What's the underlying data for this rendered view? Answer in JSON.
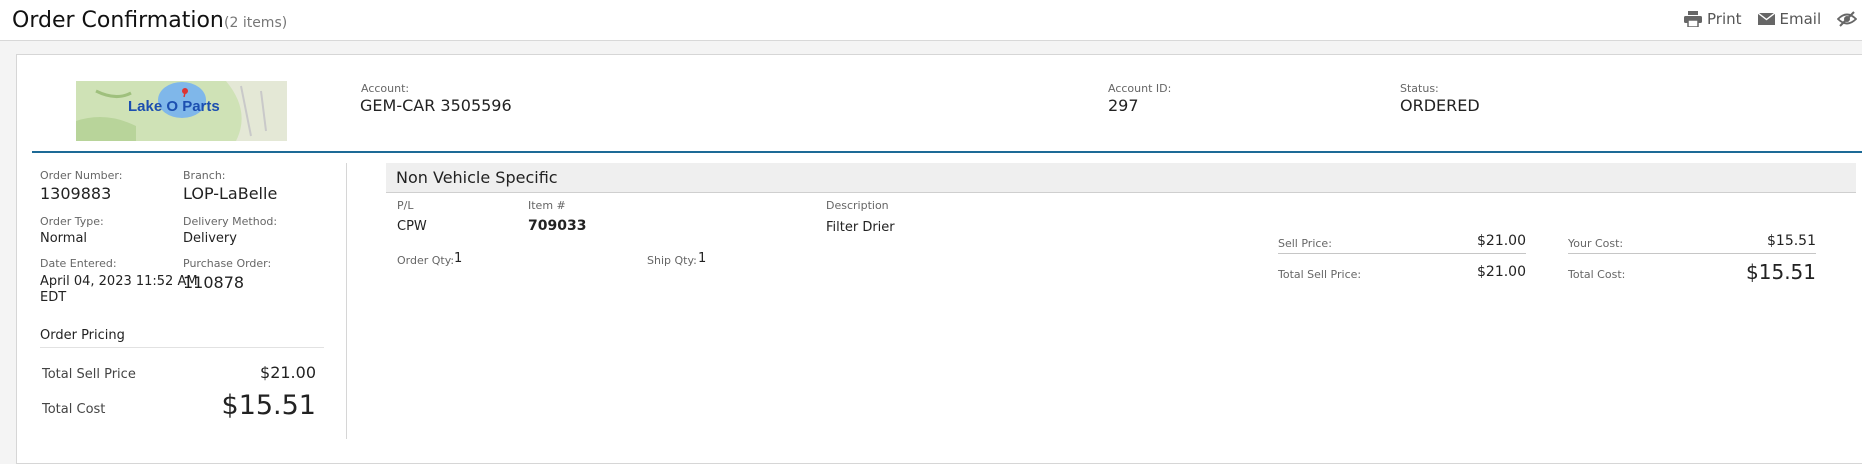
{
  "header": {
    "title": "Order Confirmation",
    "item_count": "(2 items)",
    "actions": {
      "print": "Print",
      "email": "Email"
    }
  },
  "logo": {
    "text": "Lake O Parts"
  },
  "account": {
    "account_label": "Account:",
    "account_value": "GEM-CAR 3505596",
    "account_id_label": "Account ID:",
    "account_id_value": "297",
    "status_label": "Status:",
    "status_value": "ORDERED"
  },
  "order": {
    "order_number_label": "Order Number:",
    "order_number": "1309883",
    "branch_label": "Branch:",
    "branch": "LOP-LaBelle",
    "order_type_label": "Order Type:",
    "order_type": "Normal",
    "delivery_method_label": "Delivery Method:",
    "delivery_method": "Delivery",
    "date_entered_label": "Date Entered:",
    "date_entered_line1": "April 04, 2023 11:52 AM",
    "date_entered_line2": "EDT",
    "purchase_order_label": "Purchase Order:",
    "purchase_order": "110878"
  },
  "pricing": {
    "title": "Order Pricing",
    "total_sell_label": "Total Sell Price",
    "total_sell_value": "$21.00",
    "total_cost_label": "Total Cost",
    "total_cost_value": "$15.51"
  },
  "line_item": {
    "section_title": "Non Vehicle Specific",
    "pl_label": "P/L",
    "pl_value": "CPW",
    "item_label": "Item #",
    "item_value": "709033",
    "desc_label": "Description",
    "desc_value": "Filter Drier",
    "order_qty_label": "Order Qty:",
    "order_qty": "1",
    "ship_qty_label": "Ship Qty:",
    "ship_qty": "1",
    "sell_price_label": "Sell Price:",
    "sell_price": "$21.00",
    "total_sell_price_label": "Total Sell Price:",
    "total_sell_price": "$21.00",
    "your_cost_label": "Your Cost:",
    "your_cost": "$15.51",
    "total_cost_label": "Total Cost:",
    "total_cost": "$15.51"
  },
  "icons": {
    "print": "printer-icon",
    "email": "envelope-icon",
    "extra": "eye-slash-icon"
  }
}
